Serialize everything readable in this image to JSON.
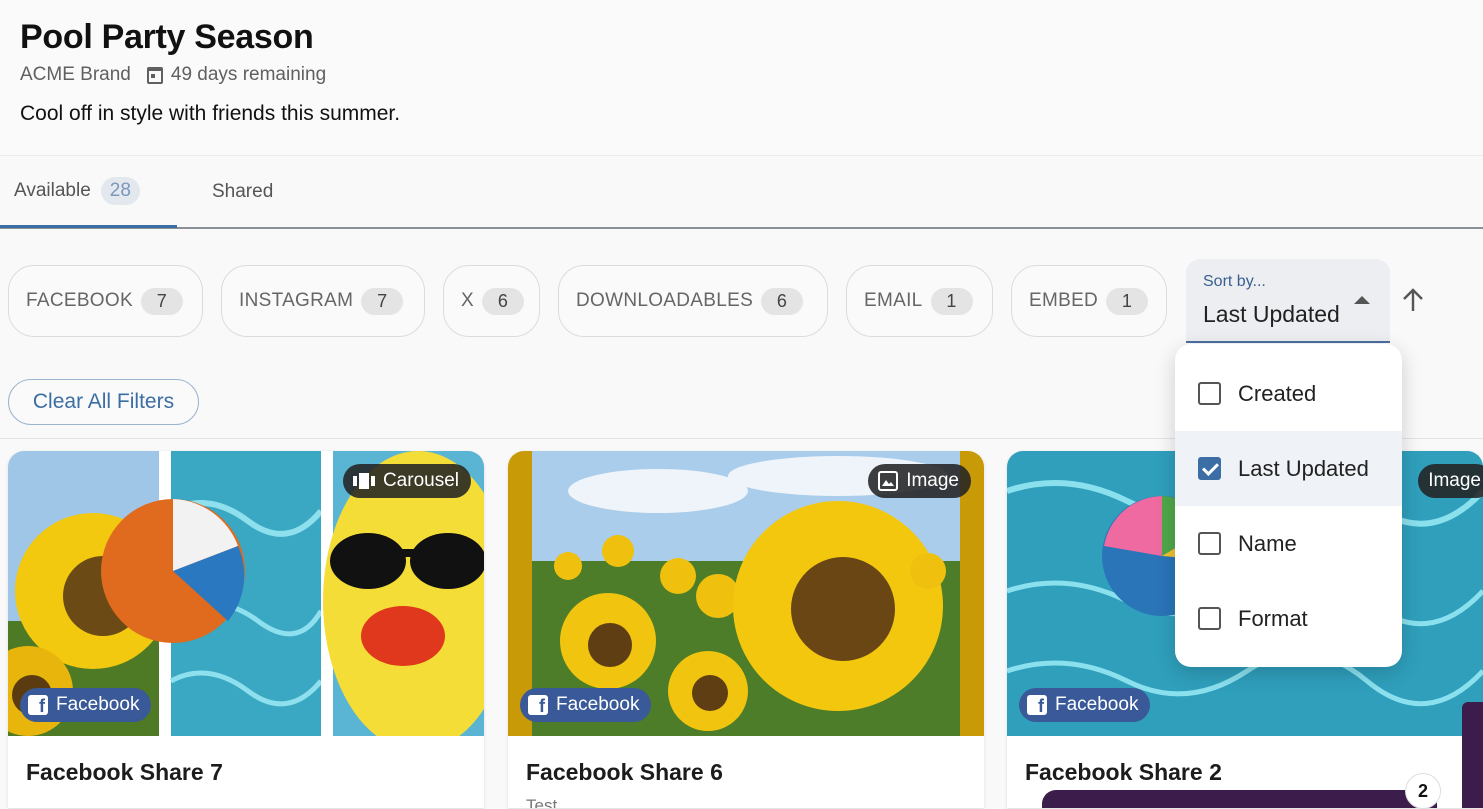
{
  "campaign": {
    "title": "Pool Party Season",
    "brand": "ACME Brand",
    "remaining": "49 days remaining",
    "description": "Cool off in style with friends this summer."
  },
  "tabs": [
    {
      "label": "Available",
      "count": "28",
      "active": true
    },
    {
      "label": "Shared"
    }
  ],
  "filters": [
    {
      "label": "FACEBOOK",
      "count": "7"
    },
    {
      "label": "INSTAGRAM",
      "count": "7"
    },
    {
      "label": "X",
      "count": "6"
    },
    {
      "label": "DOWNLOADABLES",
      "count": "6"
    },
    {
      "label": "EMAIL",
      "count": "1"
    },
    {
      "label": "EMBED",
      "count": "1"
    }
  ],
  "sort": {
    "label": "Sort by...",
    "value": "Last Updated",
    "options": [
      {
        "label": "Created",
        "checked": false
      },
      {
        "label": "Last Updated",
        "checked": true
      },
      {
        "label": "Name",
        "checked": false
      },
      {
        "label": "Format",
        "checked": false
      }
    ]
  },
  "clear_filters": "Clear All Filters",
  "cards": [
    {
      "title": "Facebook Share 7",
      "format": "Carousel",
      "platform": "Facebook",
      "subtitle": ""
    },
    {
      "title": "Facebook Share 6",
      "format": "Image",
      "platform": "Facebook",
      "subtitle": "Test"
    },
    {
      "title": "Facebook Share 2",
      "format": "Image",
      "platform": "Facebook",
      "subtitle": ""
    }
  ],
  "notification_count": "2",
  "colors": {
    "accent": "#3b6ea5",
    "facebook": "#3a5998",
    "purple": "#3b1c4a"
  }
}
